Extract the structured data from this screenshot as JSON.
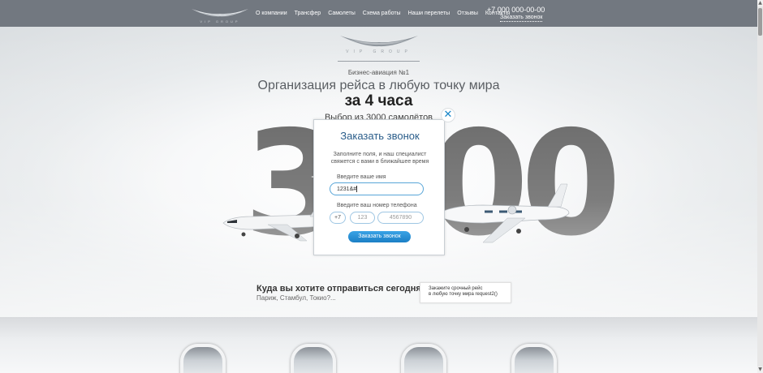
{
  "header": {
    "logo_text": "VIP GROUP",
    "nav": [
      "О компании",
      "Трансфер",
      "Самолеты",
      "Схема работы",
      "Наши перелеты",
      "Отзывы",
      "Контакты"
    ],
    "phone": "+7 000 000-00-00",
    "callback_link": "Заказать звонок"
  },
  "hero": {
    "logo_text": "VIP GROUP",
    "subtitle": "Бизнес-авиация №1",
    "headline": "Организация рейса в любую точку мира",
    "headline_bold": "за 4 часа",
    "choice": "Выбор из 3000 самолётов",
    "big_number": "3000",
    "question": "Куда вы хотите отправиться сегодня?",
    "question_sub": "Париж, Стамбул, Токио?...",
    "request_box": [
      "Закажите срочный рейс",
      "в любую точку мира request2()"
    ]
  },
  "modal": {
    "close": "✕",
    "title": "Заказать звонок",
    "description": [
      "Заполните поля, и наш специалист",
      "свяжется с вами в ближайшее время"
    ],
    "name_label": "Введите ваше имя",
    "name_value": "1231&#",
    "phone_label": "Введите ваш номер телефона",
    "country_code": "+7",
    "area_placeholder": "123",
    "number_placeholder": "4567890",
    "submit_label": "Заказать звонок"
  },
  "scrollbar": {
    "up": "▲",
    "down": "▼"
  }
}
